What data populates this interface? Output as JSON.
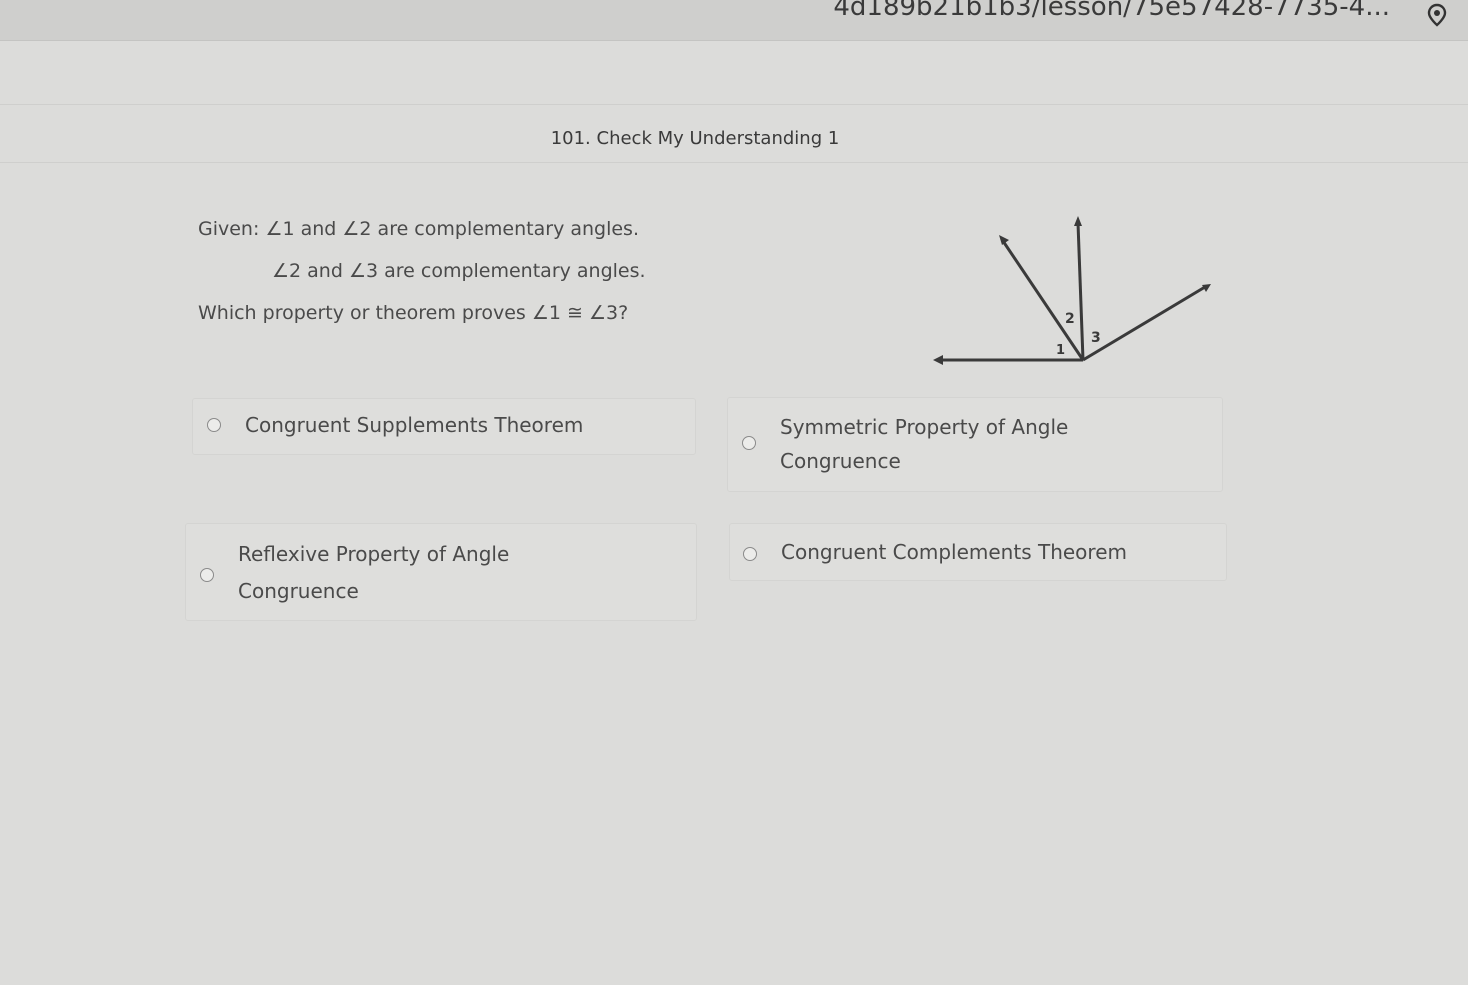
{
  "browser": {
    "url_visible": "4d189b21b1b3/lesson/75e57428-7735-4..."
  },
  "page": {
    "title": "101. Check My Understanding 1"
  },
  "question": {
    "given_label": "Given:",
    "line1": "∠1 and ∠2 are complementary angles.",
    "line2": "∠2 and ∠3 are complementary angles.",
    "prompt": "Which property or theorem proves ∠1 ≅ ∠3?"
  },
  "figure": {
    "labels": [
      "2",
      "3",
      "1"
    ]
  },
  "options": [
    {
      "label": "Congruent Supplements Theorem",
      "selected": false
    },
    {
      "label_line1": "Symmetric Property of Angle",
      "label_line2": "Congruence",
      "selected": false
    },
    {
      "label_line1": "Reflexive Property of Angle",
      "label_line2": "Congruence",
      "selected": false
    },
    {
      "label": "Congruent Complements Theorem",
      "selected": false
    }
  ]
}
